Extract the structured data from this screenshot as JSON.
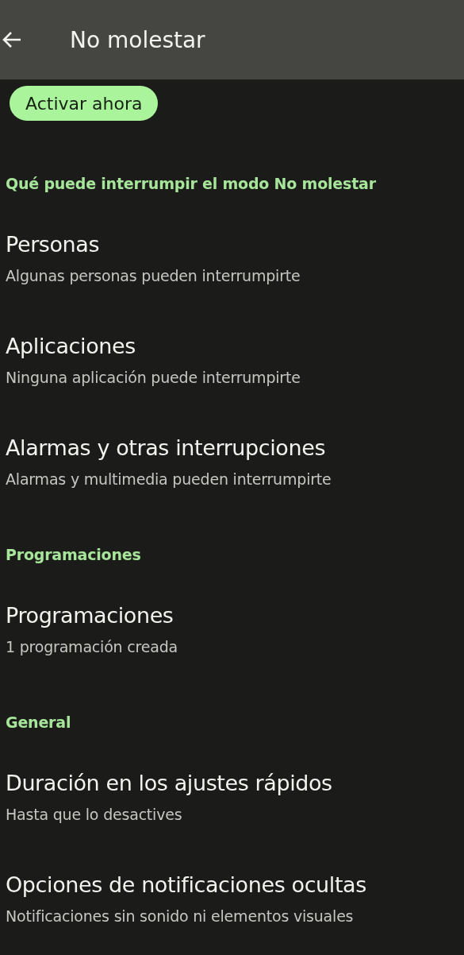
{
  "app_bar": {
    "title": "No molestar"
  },
  "action_button": {
    "label": "Activar ahora"
  },
  "sections": [
    {
      "header": "Qué puede interrumpir el modo No molestar",
      "items": [
        {
          "title": "Personas",
          "subtitle": "Algunas personas pueden interrumpirte"
        },
        {
          "title": "Aplicaciones",
          "subtitle": "Ninguna aplicación puede interrumpirte"
        },
        {
          "title": "Alarmas y otras interrupciones",
          "subtitle": "Alarmas y multimedia pueden interrumpirte"
        }
      ]
    },
    {
      "header": "Programaciones",
      "items": [
        {
          "title": "Programaciones",
          "subtitle": "1 programación creada"
        }
      ]
    },
    {
      "header": "General",
      "items": [
        {
          "title": "Duración en los ajustes rápidos",
          "subtitle": "Hasta que lo desactives"
        },
        {
          "title": "Opciones de notificaciones ocultas",
          "subtitle": "Notificaciones sin sonido ni elementos visuales"
        }
      ]
    }
  ]
}
